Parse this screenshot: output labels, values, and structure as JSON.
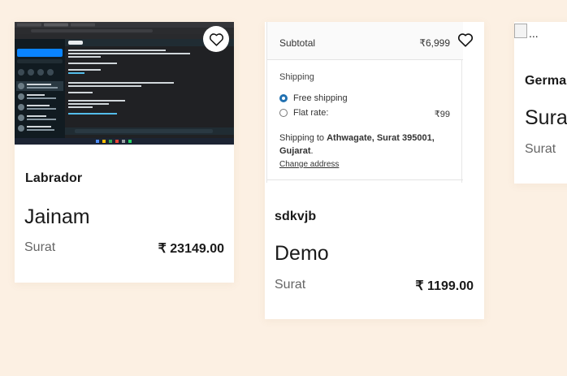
{
  "cards": [
    {
      "breed": "Labrador",
      "name": "Jainam",
      "city": "Surat",
      "price": "₹ 23149.00"
    },
    {
      "breed": "sdkvjb",
      "name": "Demo",
      "city": "Surat",
      "price": "₹ 1199.00",
      "checkout": {
        "subtotal_label": "Subtotal",
        "subtotal_value": "₹6,999",
        "shipping_heading": "Shipping",
        "free_shipping": "Free shipping",
        "flat_rate_label": "Flat rate:",
        "flat_rate_value": "₹99",
        "shipping_to_prefix": "Shipping to ",
        "shipping_to_address": "Athwagate, Surat 395001, Gujarat",
        "change_address": "Change address"
      }
    },
    {
      "breed": "Germa",
      "name": "Sura",
      "city": "Surat",
      "image_alt": "..."
    }
  ],
  "icons": {
    "favorite": "heart-outline-icon"
  },
  "colors": {
    "background": "#fcf0e3",
    "card": "#ffffff",
    "accent": "#2271b1"
  }
}
